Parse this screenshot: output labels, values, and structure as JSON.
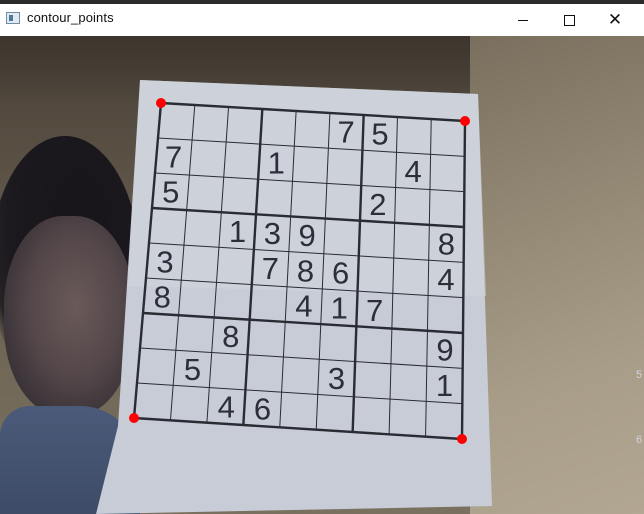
{
  "window": {
    "title": "contour_points",
    "icon": "opencv-window-icon",
    "controls": [
      "minimize-icon",
      "maximize-icon",
      "close-icon"
    ]
  },
  "sudoku": {
    "header_left": "",
    "header_right": "",
    "grid": [
      [
        "",
        "",
        "",
        "",
        "",
        "7",
        "5",
        "",
        ""
      ],
      [
        "7",
        "",
        "",
        "1",
        "",
        "",
        "",
        "4",
        ""
      ],
      [
        "5",
        "",
        "",
        "",
        "",
        "",
        "2",
        "",
        ""
      ],
      [
        "",
        "",
        "1",
        "3",
        "9",
        "",
        "",
        "",
        "8"
      ],
      [
        "3",
        "",
        "",
        "7",
        "8",
        "6",
        "",
        "",
        "4"
      ],
      [
        "8",
        "",
        "",
        "",
        "4",
        "1",
        "7",
        "",
        ""
      ],
      [
        "",
        "",
        "8",
        "",
        "",
        "",
        "",
        "",
        "9"
      ],
      [
        "",
        "5",
        "",
        "",
        "",
        "3",
        "",
        "",
        "1"
      ],
      [
        "",
        "",
        "4",
        "6",
        "",
        "",
        "",
        "",
        ""
      ]
    ]
  },
  "contour_points": {
    "color": "#ff0000",
    "count": 4
  },
  "edge_marks": [
    "5",
    "6"
  ]
}
